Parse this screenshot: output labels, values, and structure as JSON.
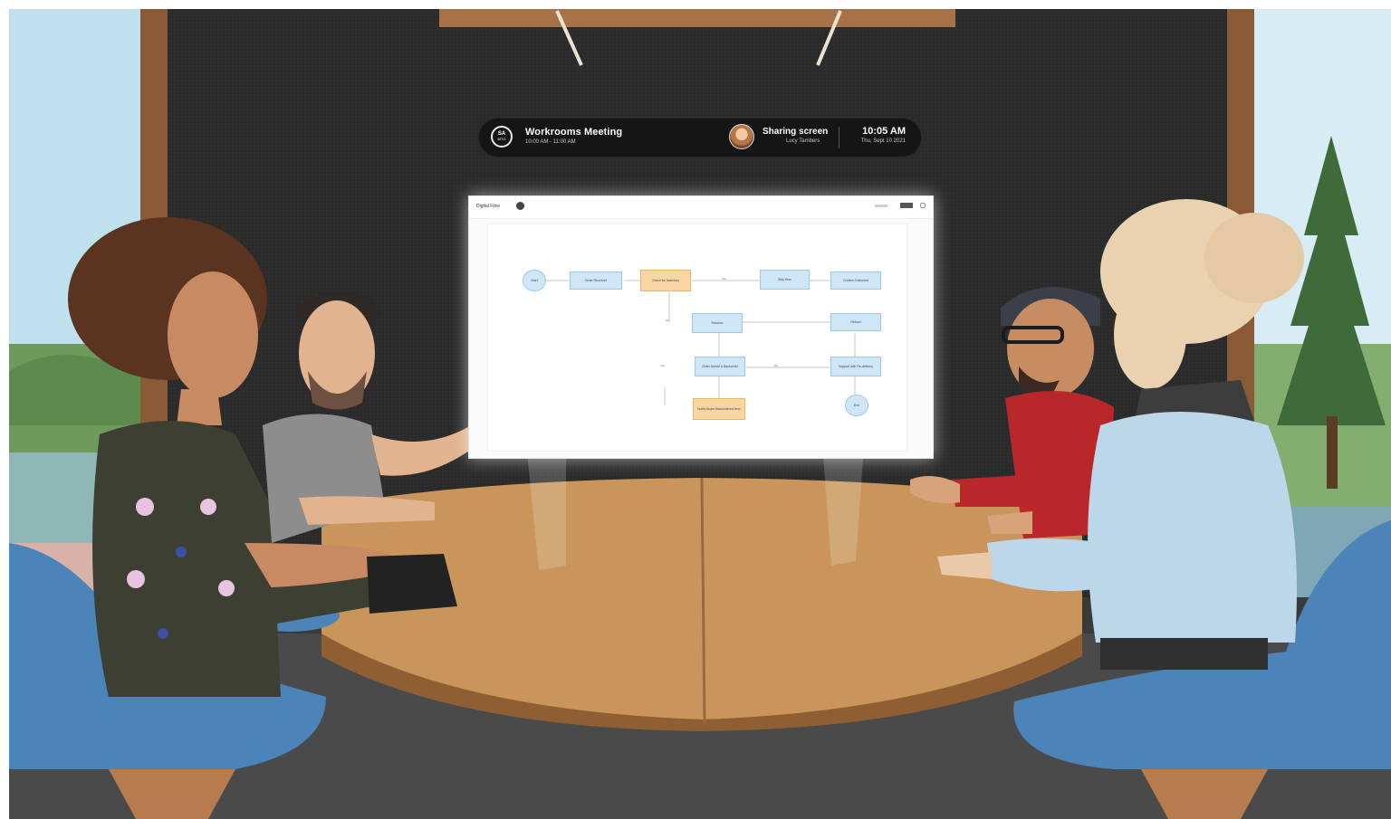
{
  "meeting_bar": {
    "logo_text": "SA",
    "logo_sub": "MTG",
    "title": "Workrooms Meeting",
    "time_range": "10:00 AM - 11:00 AM",
    "status": "Sharing screen",
    "presenter": "Lucy Tambers",
    "clock": "10:05 AM",
    "date": "Thu, Sept 10 2021"
  },
  "shared_screen": {
    "app_name": "Digital Flow",
    "nodes": [
      {
        "id": "start",
        "label": "Start",
        "style": "circle"
      },
      {
        "id": "n1",
        "label": "Order Received",
        "style": "blue"
      },
      {
        "id": "n2",
        "label": "Check for Inventory",
        "style": "orange"
      },
      {
        "id": "n3",
        "label": "Ship Item",
        "style": "blue"
      },
      {
        "id": "n4",
        "label": "Confirm Delivered",
        "style": "blue"
      },
      {
        "id": "n5",
        "label": "Restock",
        "style": "blue"
      },
      {
        "id": "n6",
        "label": "Refund",
        "style": "blue"
      },
      {
        "id": "n7",
        "label": "Order Ahead & Backorder",
        "style": "blue"
      },
      {
        "id": "n8",
        "label": "Support with Re-delivery",
        "style": "blue"
      },
      {
        "id": "n9",
        "label": "Notify Buyer Backordered Item",
        "style": "orange"
      },
      {
        "id": "end",
        "label": "End",
        "style": "circle"
      }
    ],
    "edge_labels": [
      "Yes",
      "No",
      "Yes",
      "Yes"
    ]
  },
  "colors": {
    "wall": "#2a2a2a",
    "table": "#c9955a",
    "chair": "#4a84b8",
    "wood_frame": "#8a5a36",
    "sky": "#cfe6f0"
  },
  "icons": {
    "logo": "workrooms-logo-icon",
    "presenter_avatar": "presenter-avatar-icon"
  }
}
